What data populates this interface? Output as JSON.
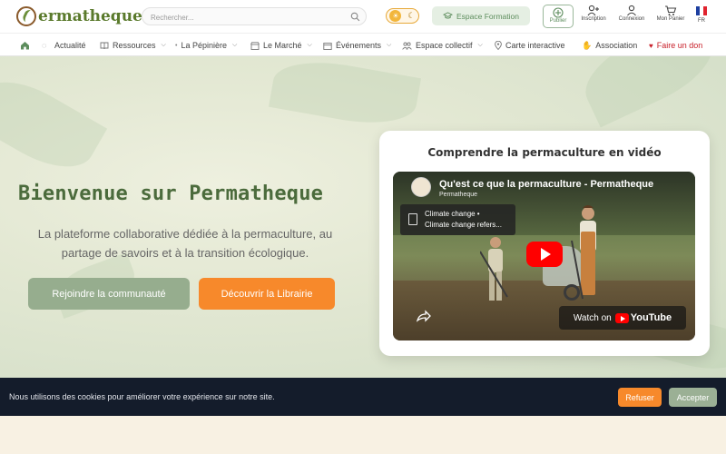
{
  "header": {
    "logo_text": "ermatheque",
    "search_placeholder": "Rechercher...",
    "formation_label": "Espace Formation",
    "publish_label": "Publier",
    "inscription_label": "Inscription",
    "connexion_label": "Connexion",
    "panier_label": "Mon Panier",
    "lang_label": "FR"
  },
  "nav": {
    "items": [
      {
        "label": "Actualité"
      },
      {
        "label": "Ressources"
      },
      {
        "label": "La Pépinière"
      },
      {
        "label": "Le Marché"
      },
      {
        "label": "Événements"
      },
      {
        "label": "Espace collectif"
      },
      {
        "label": "Carte interactive"
      },
      {
        "label": "Association"
      },
      {
        "label": "Faire un don"
      }
    ]
  },
  "hero": {
    "title": "Bienvenue sur Permatheque",
    "subtitle": "La plateforme collaborative dédiée à la permaculture, au partage de savoirs et à la transition écologique.",
    "join_label": "Rejoindre la communauté",
    "library_label": "Découvrir la Librairie"
  },
  "video_card": {
    "title": "Comprendre la permaculture en vidéo",
    "video_title": "Qu'est ce que la permaculture - Permatheque",
    "channel": "Permatheque",
    "chapter_line1": "Climate change •",
    "chapter_line2": "Climate change refers...",
    "watch_on": "Watch on",
    "youtube": "YouTube"
  },
  "cookie": {
    "text": "Nous utilisons des cookies pour améliorer votre expérience sur notre site.",
    "refuse_label": "Refuser",
    "accept_label": "Accepter"
  },
  "colors": {
    "brand_green": "#5a7a2c",
    "accent_orange": "#f7892b",
    "sage": "#96ad8e",
    "cookie_bg": "#141c2b",
    "don_red": "#c8202a"
  },
  "icons": [
    "home-icon",
    "search-icon",
    "sun-icon",
    "moon-icon",
    "graduation-icon",
    "plus-circle-icon",
    "user-plus-icon",
    "user-icon",
    "cart-icon",
    "flag-fr-icon",
    "heart-icon",
    "play-icon",
    "share-icon",
    "youtube-icon"
  ]
}
